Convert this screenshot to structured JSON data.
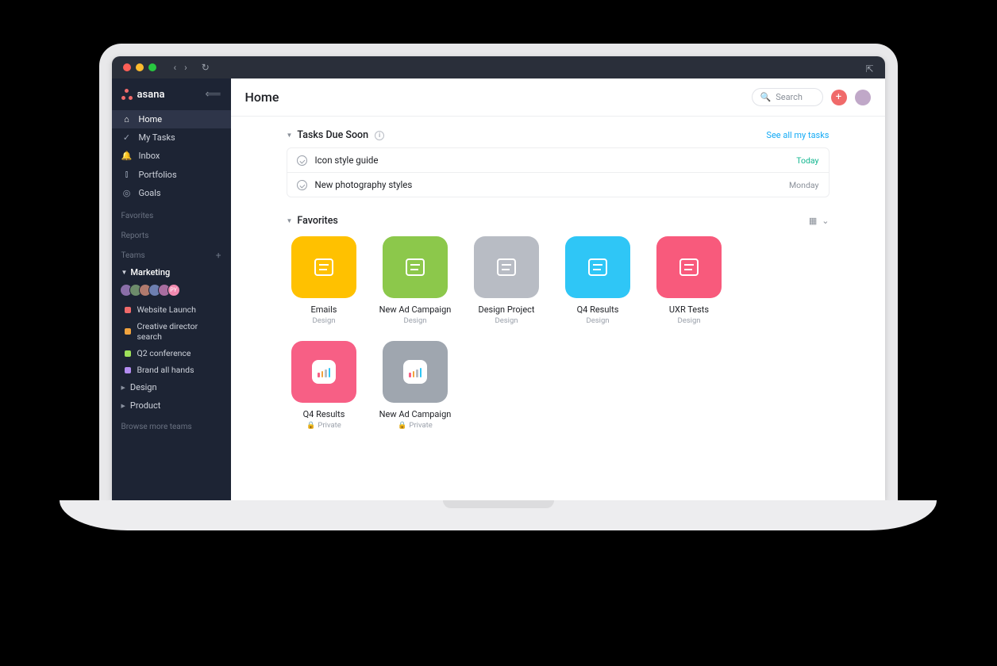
{
  "brand": "asana",
  "sidebar": {
    "nav": [
      {
        "label": "Home",
        "icon": "home-icon",
        "glyph": "⌂"
      },
      {
        "label": "My Tasks",
        "icon": "check-circle-icon",
        "glyph": "✓"
      },
      {
        "label": "Inbox",
        "icon": "bell-icon",
        "glyph": "🔔"
      },
      {
        "label": "Portfolios",
        "icon": "bars-icon",
        "glyph": "⫾"
      },
      {
        "label": "Goals",
        "icon": "target-icon",
        "glyph": "◎"
      }
    ],
    "favorites_label": "Favorites",
    "reports_label": "Reports",
    "teams_label": "Teams",
    "team": {
      "name": "Marketing",
      "avatars": [
        "",
        "",
        "",
        "",
        "",
        "PY"
      ],
      "projects": [
        {
          "label": "Website Launch",
          "color": "#f06a6a"
        },
        {
          "label": "Creative director search",
          "color": "#f1a33e"
        },
        {
          "label": "Q2 conference",
          "color": "#9ee05a"
        },
        {
          "label": "Brand all hands",
          "color": "#b38cf0"
        }
      ],
      "collapsed": [
        {
          "label": "Design"
        },
        {
          "label": "Product"
        }
      ]
    },
    "browse": "Browse more teams"
  },
  "header": {
    "title": "Home",
    "search_placeholder": "Search"
  },
  "tasks_due": {
    "title": "Tasks Due Soon",
    "see_all": "See all my tasks",
    "rows": [
      {
        "title": "Icon style guide",
        "due": "Today",
        "today": true
      },
      {
        "title": "New photography styles",
        "due": "Monday",
        "today": false
      }
    ]
  },
  "favorites": {
    "title": "Favorites",
    "tiles": [
      {
        "type": "project",
        "title": "Emails",
        "sub": "Design",
        "color": "#ffc100"
      },
      {
        "type": "project",
        "title": "New Ad Campaign",
        "sub": "Design",
        "color": "#8cc84b"
      },
      {
        "type": "project",
        "title": "Design Project",
        "sub": "Design",
        "color": "#b8bcc4"
      },
      {
        "type": "project",
        "title": "Q4 Results",
        "sub": "Design",
        "color": "#2fc6f6"
      },
      {
        "type": "project",
        "title": "UXR Tests",
        "sub": "Design",
        "color": "#f85a7c"
      },
      {
        "type": "portfolio",
        "title": "Q4 Results",
        "sub": "Private",
        "back": "#f75f85",
        "bars": [
          "#f75f85",
          "#f1a33e",
          "#b8bcc4",
          "#2fc6f6"
        ]
      },
      {
        "type": "portfolio",
        "title": "New Ad Campaign",
        "sub": "Private",
        "back": "#9fa6af",
        "bars": [
          "#f75f85",
          "#f1a33e",
          "#b8bcc4",
          "#2fc6f6"
        ]
      }
    ]
  }
}
